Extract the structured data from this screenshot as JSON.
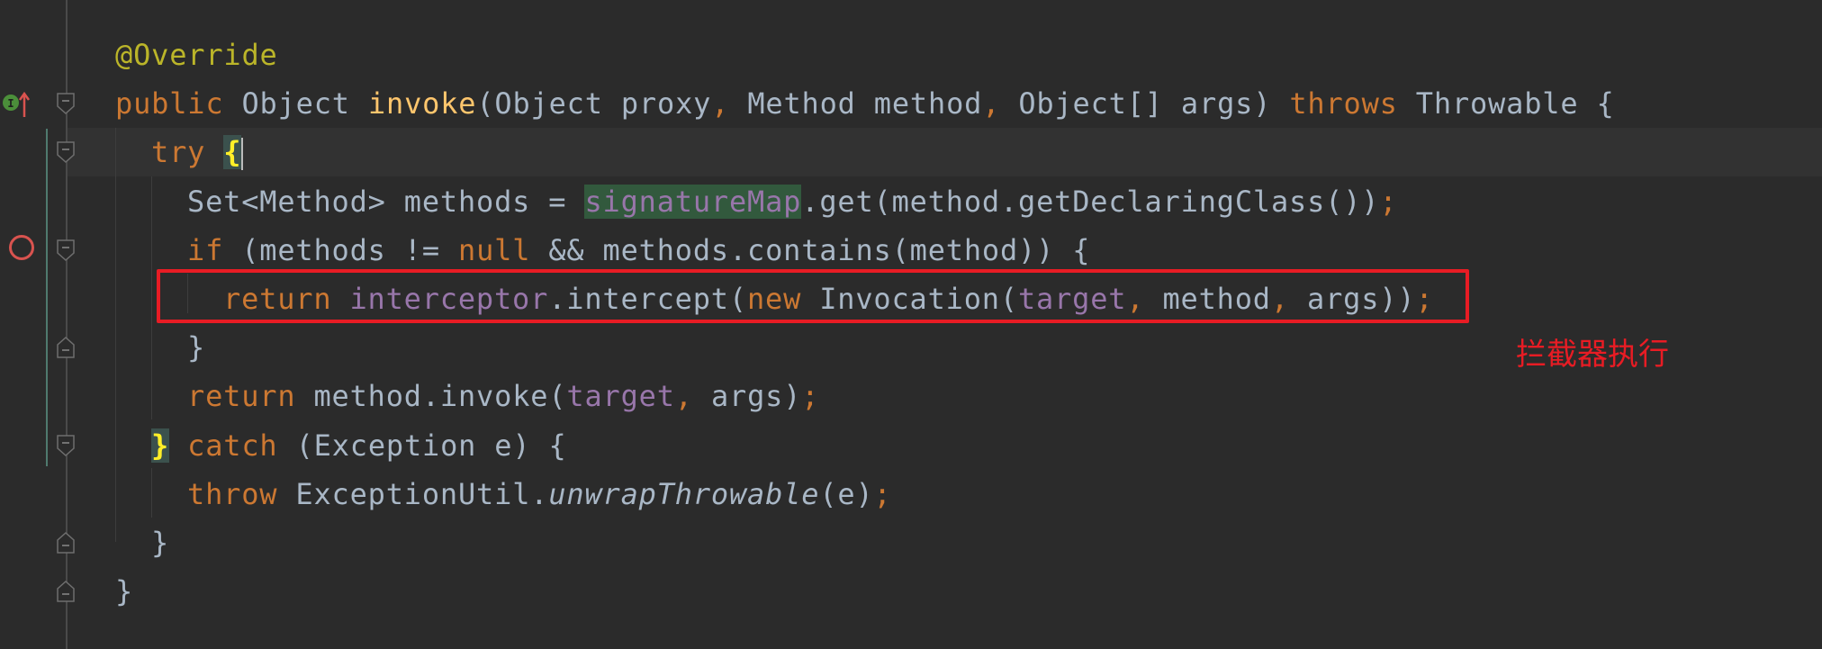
{
  "editor": {
    "lines": [
      {
        "indent": 0,
        "tokens": [
          [
            "ann",
            "@Override"
          ]
        ]
      },
      {
        "indent": 0,
        "tokens": [
          [
            "kw",
            "public "
          ],
          [
            "",
            "Object "
          ],
          [
            "fn",
            "invoke"
          ],
          [
            "",
            "(Object proxy"
          ],
          [
            "kw",
            ", "
          ],
          [
            "",
            "Method method"
          ],
          [
            "kw",
            ", "
          ],
          [
            "",
            "Object[] args) "
          ],
          [
            "kw",
            "throws "
          ],
          [
            "",
            "Throwable {"
          ]
        ]
      },
      {
        "indent": 1,
        "tokens": [
          [
            "kw",
            "try "
          ],
          [
            "brace",
            "{"
          ],
          [
            "caret",
            ""
          ]
        ]
      },
      {
        "indent": 2,
        "tokens": [
          [
            "",
            "Set<Method> methods = "
          ],
          [
            "fld hl",
            "signatureMap"
          ],
          [
            "",
            ".get(method.getDeclaringClass())"
          ],
          [
            "kw",
            ";"
          ]
        ]
      },
      {
        "indent": 2,
        "tokens": [
          [
            "kw",
            "if "
          ],
          [
            "",
            "(methods != "
          ],
          [
            "kw",
            "null "
          ],
          [
            "",
            "&& methods.contains(method)) {"
          ]
        ]
      },
      {
        "indent": 3,
        "tokens": [
          [
            "kw",
            "return "
          ],
          [
            "fld",
            "interceptor"
          ],
          [
            "",
            ".intercept("
          ],
          [
            "kw",
            "new "
          ],
          [
            "",
            "Invocation("
          ],
          [
            "fld",
            "target"
          ],
          [
            "kw",
            ", "
          ],
          [
            "",
            "method"
          ],
          [
            "kw",
            ", "
          ],
          [
            "",
            "args))"
          ],
          [
            "kw",
            ";"
          ]
        ]
      },
      {
        "indent": 2,
        "tokens": [
          [
            "",
            "}"
          ]
        ]
      },
      {
        "indent": 2,
        "tokens": [
          [
            "kw",
            "return "
          ],
          [
            "",
            "method.invoke("
          ],
          [
            "fld",
            "target"
          ],
          [
            "kw",
            ", "
          ],
          [
            "",
            "args)"
          ],
          [
            "kw",
            ";"
          ]
        ]
      },
      {
        "indent": 1,
        "tokens": [
          [
            "brace",
            "}"
          ],
          [
            "",
            " "
          ],
          [
            "kw",
            "catch "
          ],
          [
            "",
            "(Exception e) {"
          ]
        ]
      },
      {
        "indent": 2,
        "tokens": [
          [
            "kw",
            "throw "
          ],
          [
            "",
            "ExceptionUtil."
          ],
          [
            "it",
            "unwrapThrowable"
          ],
          [
            "",
            "(e)"
          ],
          [
            "kw",
            ";"
          ]
        ]
      },
      {
        "indent": 1,
        "tokens": [
          [
            "",
            "}"
          ]
        ]
      },
      {
        "indent": 0,
        "tokens": [
          [
            "",
            "}"
          ]
        ]
      }
    ]
  },
  "annotation": {
    "text": "拦截器执行",
    "color": "#e81c24"
  },
  "gutter": {
    "implements_icon": "implements-method-icon",
    "breakpoint_icon": "breakpoint-icon"
  },
  "colors": {
    "background": "#2b2b2b",
    "keyword": "#cc7832",
    "text": "#a9b7c6",
    "annotation": "#bbb529",
    "method": "#ffc66d",
    "field": "#9876aa"
  }
}
